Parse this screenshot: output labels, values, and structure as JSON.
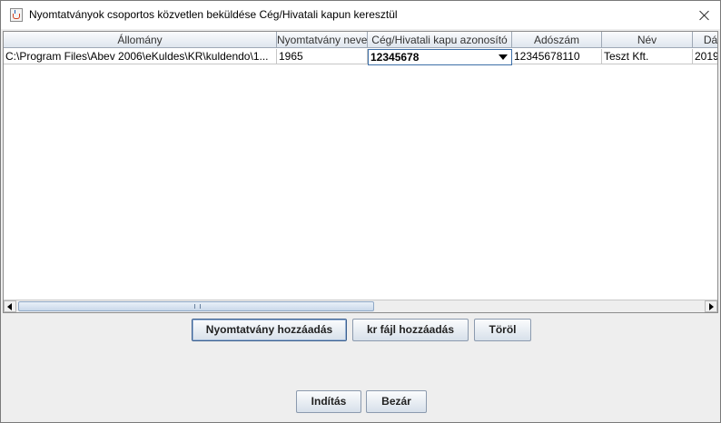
{
  "window": {
    "title": "Nyomtatványok csoportos közvetlen beküldése Cég/Hivatali kapun keresztül"
  },
  "table": {
    "columns": [
      "Állomány",
      "Nyomtatvány neve",
      "Cég/Hivatali kapu azonosító",
      "Adószám",
      "Név",
      "Dá"
    ],
    "rows": [
      {
        "file": "C:\\Program Files\\Abev 2006\\eKuldes\\KR\\kuldendo\\1...",
        "form_name": "1965",
        "gateway_id": "12345678",
        "tax_number": "12345678110",
        "name": "Teszt Kft.",
        "date": "2019"
      }
    ]
  },
  "buttons": {
    "add_form": "Nyomtatvány hozzáadás",
    "add_kr": "kr fájl hozzáadás",
    "delete": "Töröl",
    "start": "Indítás",
    "close": "Bezár"
  }
}
